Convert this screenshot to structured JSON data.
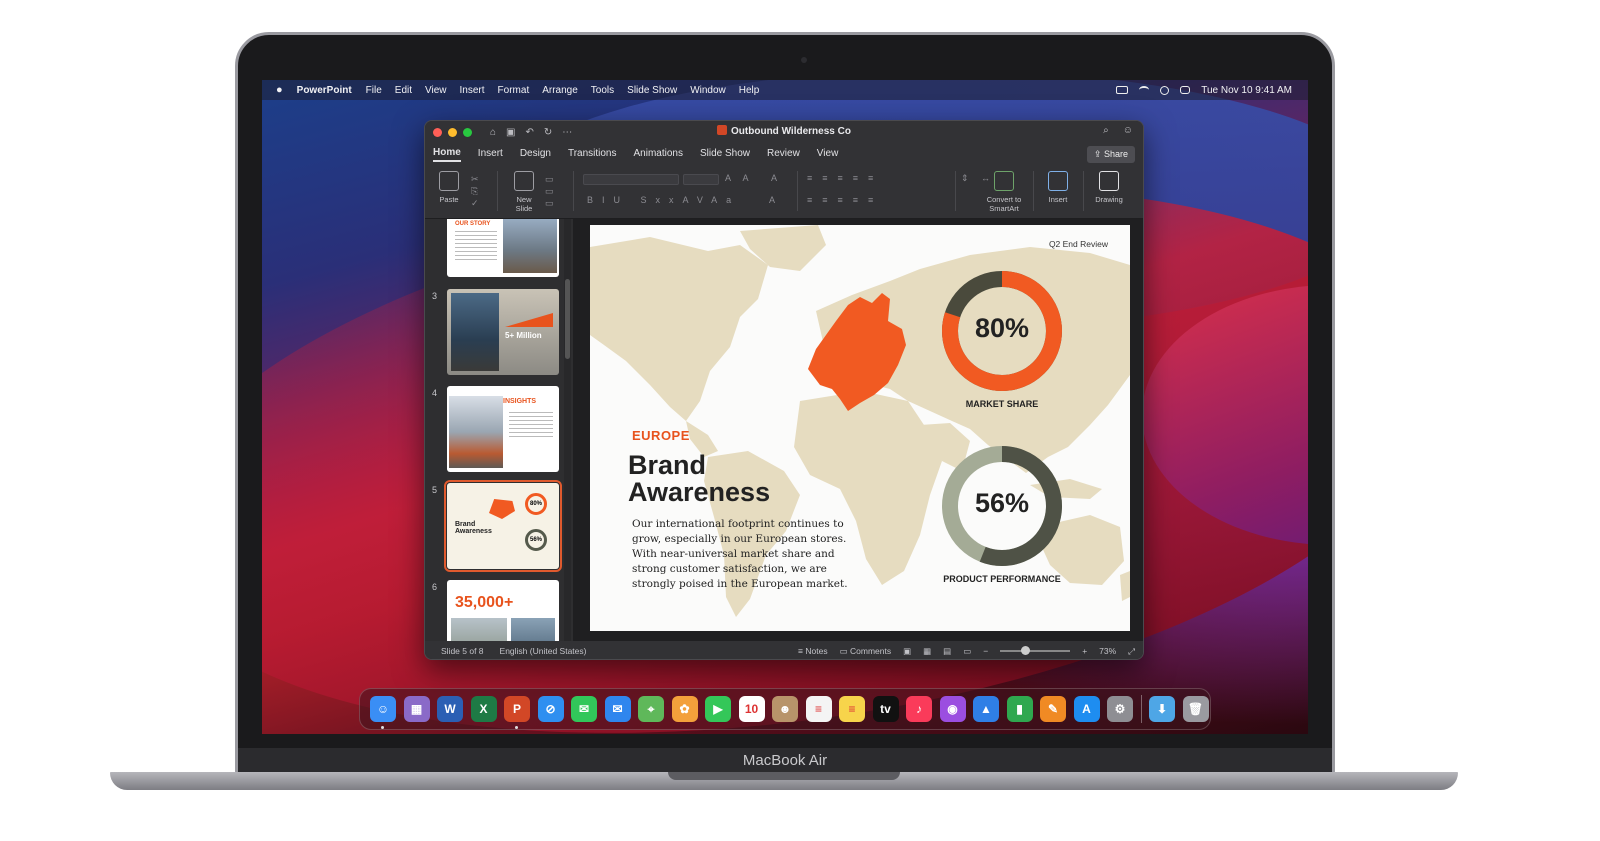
{
  "device": {
    "model_label": "MacBook Air"
  },
  "menubar": {
    "app_name": "PowerPoint",
    "items": [
      "File",
      "Edit",
      "View",
      "Insert",
      "Format",
      "Arrange",
      "Tools",
      "Slide Show",
      "Window",
      "Help"
    ],
    "clock": "Tue Nov 10  9:41 AM"
  },
  "window": {
    "doc_title": "Outbound Wilderness Co",
    "tabs": [
      "Home",
      "Insert",
      "Design",
      "Transitions",
      "Animations",
      "Slide Show",
      "Review",
      "View"
    ],
    "active_tab": "Home",
    "share_label": "Share",
    "ribbon": {
      "paste": "Paste",
      "new_slide_l1": "New",
      "new_slide_l2": "Slide",
      "convert_l1": "Convert to",
      "convert_l2": "SmartArt",
      "insert": "Insert",
      "drawing": "Drawing"
    }
  },
  "thumbnails": {
    "slide2_title": "OUR STORY",
    "slide3_number": "3",
    "slide3_stat": "5+ Million",
    "slide4_number": "4",
    "slide4_title": "INSIGHTS",
    "slide5_number": "5",
    "slide5_v1": "80%",
    "slide5_v2": "56%",
    "slide5_title_l1": "Brand",
    "slide5_title_l2": "Awareness",
    "slide6_number": "6",
    "slide6_stat": "35,000+"
  },
  "slide": {
    "review_label": "Q2 End Review",
    "kicker": "EUROPE",
    "title_line1": "Brand",
    "title_line2": "Awareness",
    "body": "Our international footprint continues to grow, especially in our European stores. With near-universal market share and strong customer satisfaction, we are strongly poised in the European market.",
    "metrics": [
      {
        "value": "80%",
        "label": "MARKET SHARE",
        "fraction": 0.8,
        "color": "#f15a22",
        "track": "#4a4a3c"
      },
      {
        "value": "56%",
        "label": "PRODUCT PERFORMANCE",
        "fraction": 0.56,
        "color": "#4f5246",
        "track": "#a4ab96"
      }
    ],
    "map_color": "#e6dcc0",
    "highlight_color": "#f15a22"
  },
  "statusbar": {
    "slide_position": "Slide 5 of 8",
    "language": "English (United States)",
    "notes": "Notes",
    "comments": "Comments",
    "zoom": "73%",
    "zoom_fraction": 0.35
  },
  "dock": {
    "apps": [
      {
        "name": "finder-icon",
        "color": "#3a8ef5",
        "glyph": "☺"
      },
      {
        "name": "launchpad-icon",
        "color": "#8a6ac8",
        "glyph": "▦"
      },
      {
        "name": "word-icon",
        "color": "#2b5fb4",
        "glyph": "W"
      },
      {
        "name": "excel-icon",
        "color": "#1e7a45",
        "glyph": "X"
      },
      {
        "name": "powerpoint-icon",
        "color": "#d24726",
        "glyph": "P"
      },
      {
        "name": "safari-icon",
        "color": "#2f8ff0",
        "glyph": "⊘"
      },
      {
        "name": "messages-icon",
        "color": "#32c75a",
        "glyph": "✉"
      },
      {
        "name": "mail-icon",
        "color": "#2f86ee",
        "glyph": "✉"
      },
      {
        "name": "maps-icon",
        "color": "#5fb85a",
        "glyph": "⌖"
      },
      {
        "name": "photos-icon",
        "color": "#f3a03b",
        "glyph": "✿"
      },
      {
        "name": "facetime-icon",
        "color": "#34c759",
        "glyph": "▶"
      },
      {
        "name": "calendar-icon",
        "color": "#ffffff",
        "glyph": "10"
      },
      {
        "name": "contacts-icon",
        "color": "#b8946a",
        "glyph": "☻"
      },
      {
        "name": "reminders-icon",
        "color": "#f4f4f4",
        "glyph": "≡"
      },
      {
        "name": "notes-icon",
        "color": "#f7d44b",
        "glyph": "≡"
      },
      {
        "name": "tv-icon",
        "color": "#111111",
        "glyph": "tv"
      },
      {
        "name": "music-icon",
        "color": "#fa3b5a",
        "glyph": "♪"
      },
      {
        "name": "podcasts-icon",
        "color": "#9b4ee0",
        "glyph": "◉"
      },
      {
        "name": "keynote-icon",
        "color": "#2f7fe6",
        "glyph": "▲"
      },
      {
        "name": "numbers-icon",
        "color": "#2fa84f",
        "glyph": "▮"
      },
      {
        "name": "pages-icon",
        "color": "#f08a24",
        "glyph": "✎"
      },
      {
        "name": "app-store-icon",
        "color": "#1e8df0",
        "glyph": "A"
      },
      {
        "name": "system-preferences-icon",
        "color": "#8e8e93",
        "glyph": "⚙"
      },
      {
        "name": "downloads-folder-icon",
        "color": "#4ea6e6",
        "glyph": "⬇"
      },
      {
        "name": "trash-icon",
        "color": "#9a9aa0",
        "glyph": "🗑"
      }
    ],
    "running": [
      "finder-icon",
      "powerpoint-icon"
    ]
  }
}
